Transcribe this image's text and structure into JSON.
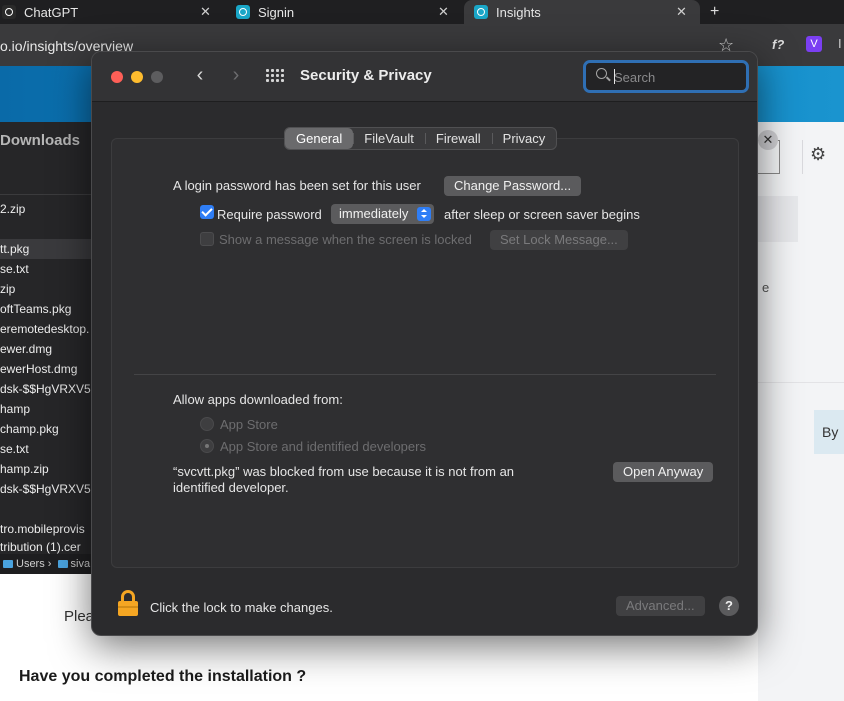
{
  "browser": {
    "tabs": [
      {
        "label": "ChatGPT"
      },
      {
        "label": "Signin"
      },
      {
        "label": "Insights"
      }
    ],
    "new_tab": "+",
    "url": "o.io/insights/overview",
    "extension_f": "f?",
    "extension_v": "V"
  },
  "finder": {
    "title": "Downloads",
    "items": [
      "2.zip",
      "tt.pkg",
      "se.txt",
      "zip",
      "oftTeams.pkg",
      "eremotedesktop.",
      "ewer.dmg",
      "ewerHost.dmg",
      "dsk-$$HgVRXV5",
      "hamp",
      "champ.pkg",
      "se.txt",
      "hamp.zip",
      "dsk-$$HgVRXV5",
      "tro.mobileprovis",
      "tribution (1).cer"
    ],
    "path": [
      "Users",
      "siva"
    ]
  },
  "page": {
    "please_text": "Plea",
    "question": "Have you completed the installation ?",
    "right_e": "e",
    "right_by": "By"
  },
  "window": {
    "title": "Security & Privacy",
    "search_placeholder": "Search",
    "tabs": [
      "General",
      "FileVault",
      "Firewall",
      "Privacy"
    ],
    "active_tab": "General",
    "login_password_text": "A login password has been set for this user",
    "change_password_button": "Change Password...",
    "require_password_label": "Require password",
    "require_password_value": "immediately",
    "after_sleep_text": "after sleep or screen saver begins",
    "show_message_label": "Show a message when the screen is locked",
    "set_lock_message_button": "Set Lock Message...",
    "allow_apps_label": "Allow apps downloaded from:",
    "radio_app_store": "App Store",
    "radio_app_store_identified": "App Store and identified developers",
    "blocked_message_line1": "“svcvtt.pkg” was blocked from use because it is not from an",
    "blocked_message_line2": "identified developer.",
    "open_anyway_button": "Open Anyway",
    "lock_text": "Click the lock to make changes.",
    "advanced_button": "Advanced...",
    "help_button": "?"
  },
  "colors": {
    "accent": "#2f7ef6",
    "search_focus": "#2f6fb4",
    "lock": "#f5a623"
  }
}
